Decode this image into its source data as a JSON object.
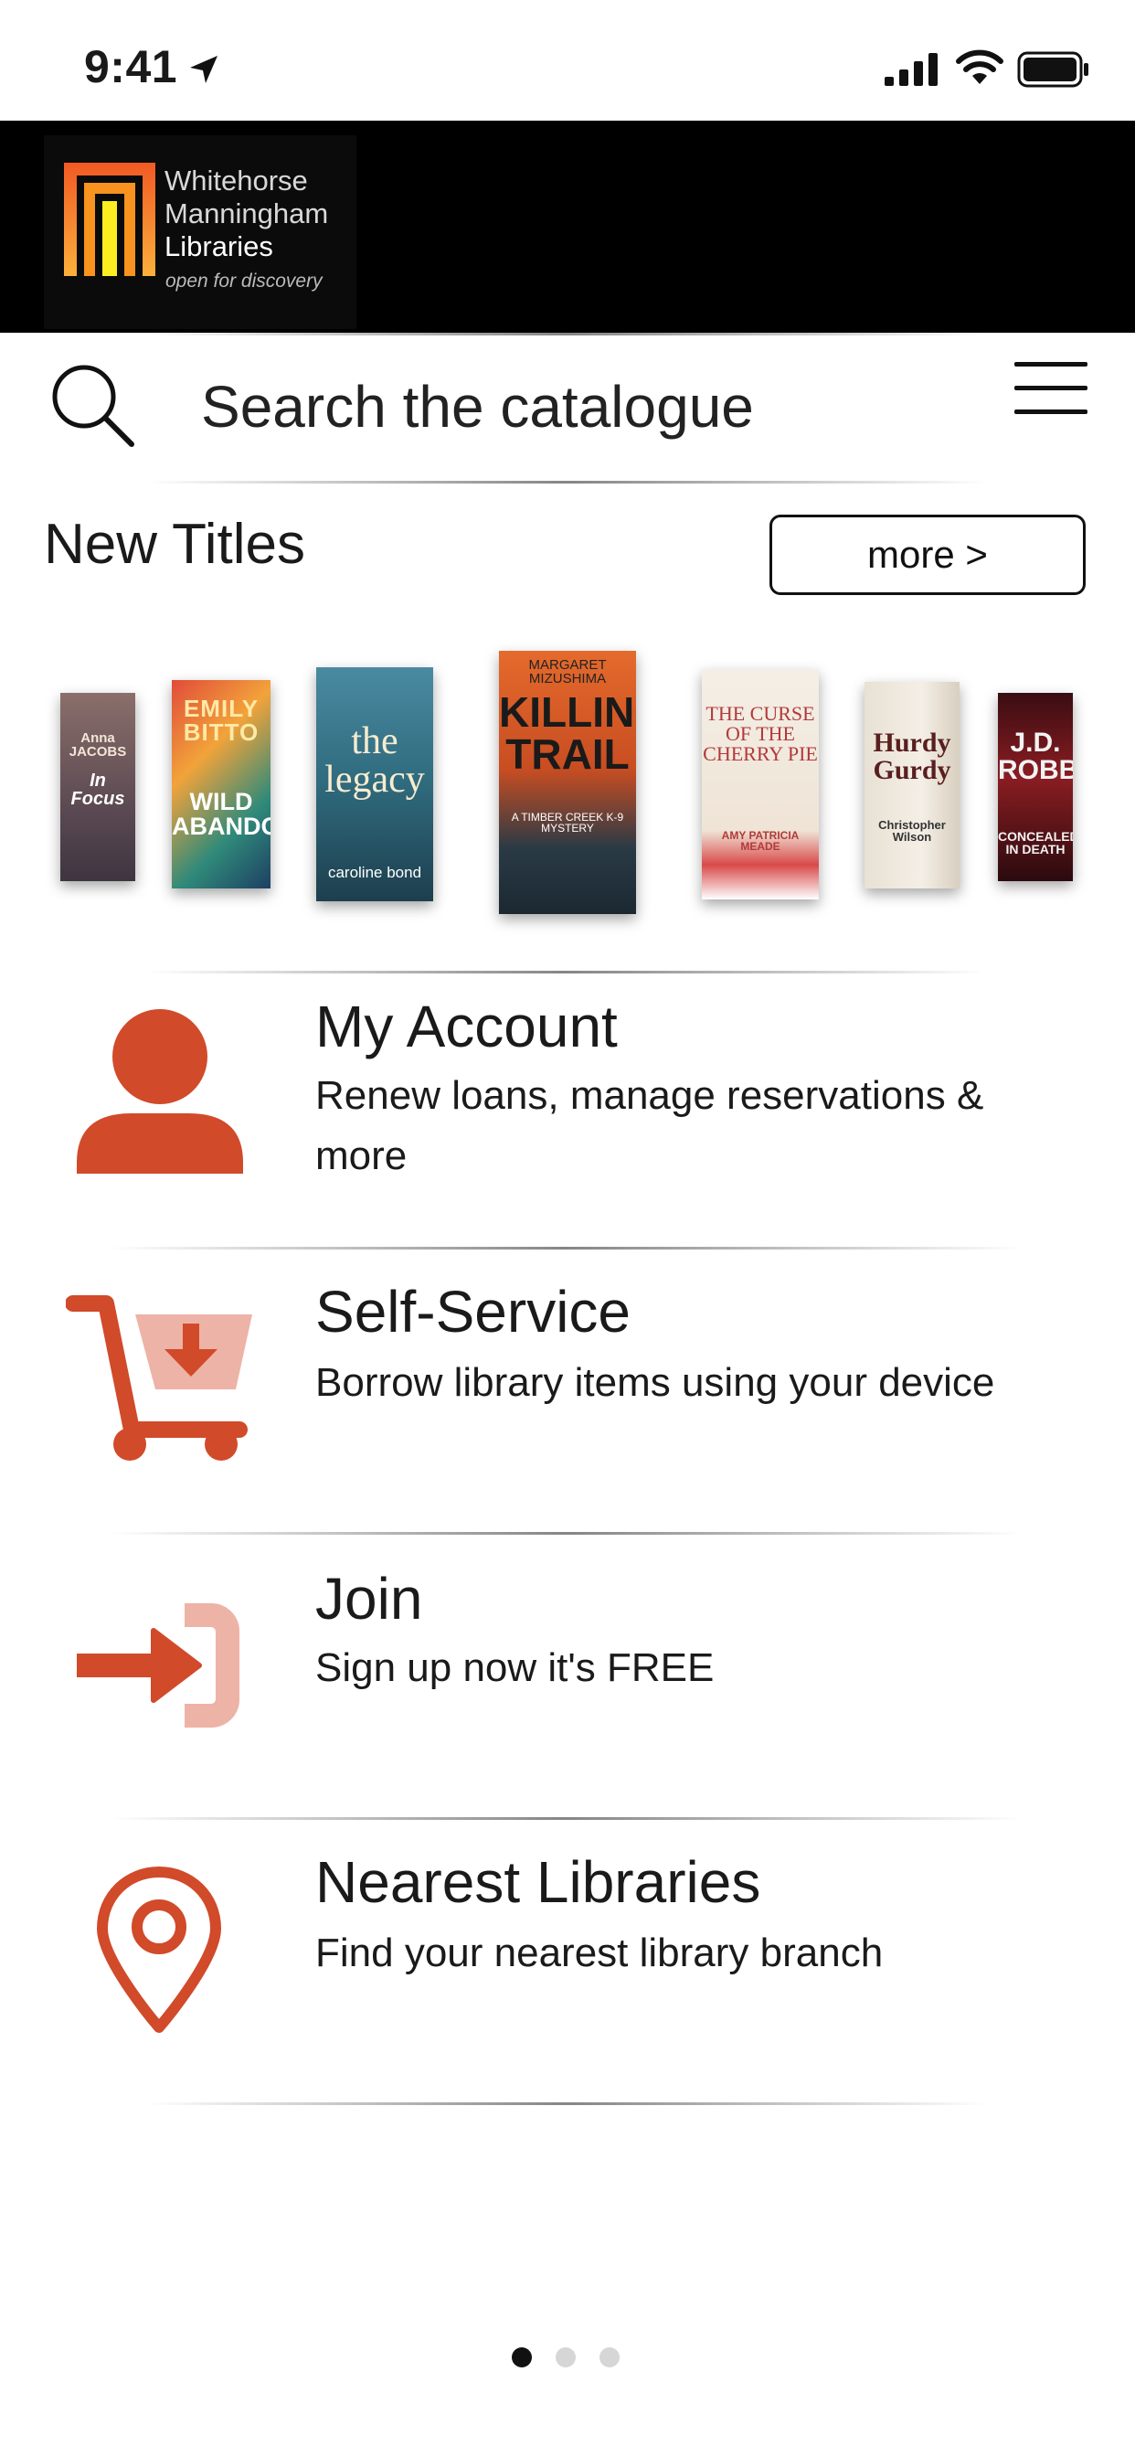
{
  "status_bar": {
    "time": "9:41"
  },
  "header": {
    "logo_line1": "Whitehorse",
    "logo_line2": "Manningham",
    "logo_line3": "Libraries",
    "logo_tagline": "open for discovery"
  },
  "search": {
    "placeholder": "Search the catalogue"
  },
  "new_titles": {
    "heading": "New Titles",
    "more_label": "more >",
    "books": [
      {
        "author": "Anna JACOBS",
        "title": "In Focus"
      },
      {
        "author": "EMILY BITTO",
        "title": "WILD ABANDON"
      },
      {
        "title": "the legacy",
        "author": "caroline bond"
      },
      {
        "author": "MARGARET MIZUSHIMA",
        "title": "KILLING TRAIL",
        "series": "A TIMBER CREEK K-9 MYSTERY"
      },
      {
        "title": "THE CURSE OF THE CHERRY PIE",
        "author": "AMY PATRICIA MEADE"
      },
      {
        "title": "Hurdy Gurdy",
        "author": "Christopher Wilson"
      },
      {
        "author": "J.D. ROBB",
        "title": "CONCEALED IN DEATH"
      }
    ]
  },
  "menu": [
    {
      "title": "My Account",
      "subtitle": "Renew loans, manage reservations & more",
      "icon": "account-icon"
    },
    {
      "title": "Self-Service",
      "subtitle": "Borrow library items using your device",
      "icon": "cart-icon"
    },
    {
      "title": "Join",
      "subtitle": "Sign up now it's FREE",
      "icon": "join-icon"
    },
    {
      "title": "Nearest Libraries",
      "subtitle": "Find your nearest library branch",
      "icon": "location-pin-icon"
    }
  ],
  "pager": {
    "page_count": 3,
    "active_index": 0
  },
  "colors": {
    "accent": "#D14A2A",
    "accent_light": "#EDB3A6",
    "header_bg": "#000000"
  }
}
